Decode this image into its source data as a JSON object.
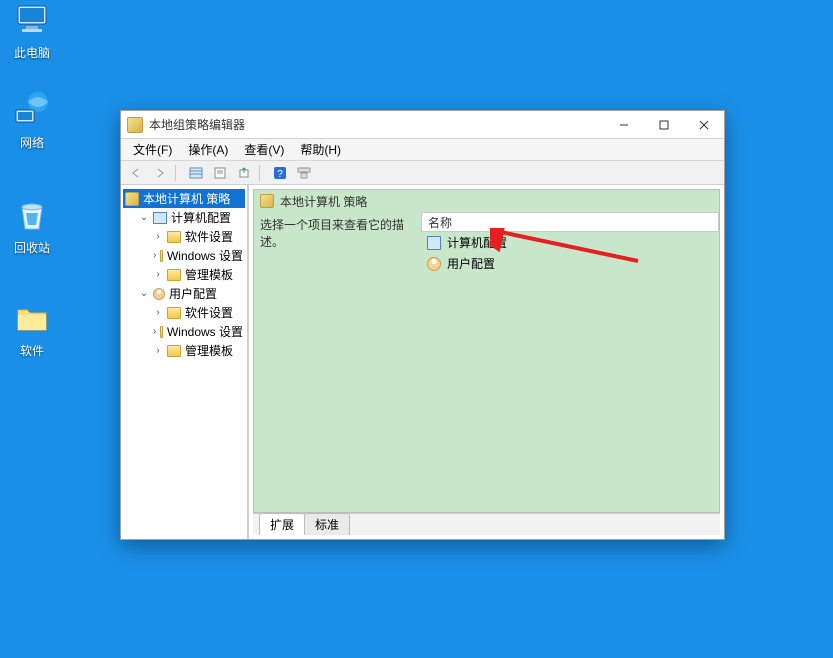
{
  "desktop": {
    "icons": [
      {
        "name": "thispc",
        "label": "此电脑"
      },
      {
        "name": "network",
        "label": "网络"
      },
      {
        "name": "recyclebin",
        "label": "回收站"
      },
      {
        "name": "software",
        "label": "软件"
      }
    ]
  },
  "window": {
    "title": "本地组策略编辑器",
    "menus": [
      {
        "name": "file",
        "label": "文件(F)"
      },
      {
        "name": "action",
        "label": "操作(A)"
      },
      {
        "name": "view",
        "label": "查看(V)"
      },
      {
        "name": "help",
        "label": "帮助(H)"
      }
    ],
    "tree": {
      "root_label": "本地计算机 策略",
      "computer": {
        "label": "计算机配置",
        "children": [
          {
            "name": "software-settings",
            "label": "软件设置"
          },
          {
            "name": "windows-settings",
            "label": "Windows 设置"
          },
          {
            "name": "admin-templates",
            "label": "管理模板"
          }
        ]
      },
      "user": {
        "label": "用户配置",
        "children": [
          {
            "name": "software-settings",
            "label": "软件设置"
          },
          {
            "name": "windows-settings",
            "label": "Windows 设置"
          },
          {
            "name": "admin-templates",
            "label": "管理模板"
          }
        ]
      }
    },
    "right": {
      "header_label": "本地计算机 策略",
      "description": "选择一个项目来查看它的描述。",
      "column_name": "名称",
      "items": [
        {
          "name": "computer-config",
          "label": "计算机配置",
          "icon": "comp"
        },
        {
          "name": "user-config",
          "label": "用户配置",
          "icon": "user"
        }
      ],
      "tabs": [
        {
          "name": "extended",
          "label": "扩展"
        },
        {
          "name": "standard",
          "label": "标准"
        }
      ]
    }
  }
}
